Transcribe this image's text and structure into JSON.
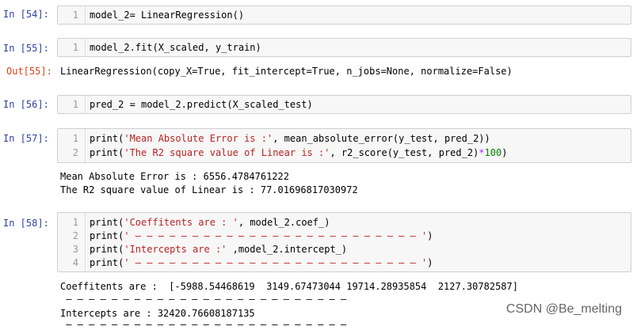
{
  "cells": [
    {
      "prompt": "In  [54]:",
      "lines": [
        {
          "n": "1",
          "text": "model_2= LinearRegression()"
        }
      ]
    },
    {
      "prompt": "In  [55]:",
      "lines": [
        {
          "n": "1",
          "text": "model_2.fit(X_scaled, y_train)"
        }
      ],
      "out_prompt": "Out[55]:",
      "output": "LinearRegression(copy_X=True, fit_intercept=True, n_jobs=None, normalize=False)"
    },
    {
      "prompt": "In  [56]:",
      "lines": [
        {
          "n": "1",
          "text": "pred_2 = model_2.predict(X_scaled_test)"
        }
      ]
    },
    {
      "prompt": "In  [57]:",
      "lines": [
        {
          "n": "1",
          "pre": "print(",
          "str": "'Mean Absolute Error is :'",
          "post": ", mean_absolute_error(y_test, pred_2))"
        },
        {
          "n": "2",
          "pre": "print(",
          "str": "'The R2 square value of Linear is :'",
          "post": ", r2_score(y_test, pred_2)",
          "op": "*",
          "num": "100",
          "end": ")"
        }
      ],
      "output_lines": [
        "Mean Absolute Error is : 6556.4784761222",
        "The R2 square value of Linear is : 77.01696817030972"
      ]
    },
    {
      "prompt": "In  [58]:",
      "lines": [
        {
          "n": "1",
          "pre": "print(",
          "str": "'Coeffitents are : '",
          "post": ", model_2.coef_)"
        },
        {
          "n": "2",
          "pre": "print(",
          "str": "' — — — — — — — — — — — — — — — — — — — — — — — — — '",
          "post": ")"
        },
        {
          "n": "3",
          "pre": "print(",
          "str": "'Intercepts are :'",
          "post": " ,model_2.intercept_)"
        },
        {
          "n": "4",
          "pre": "print(",
          "str": "' — — — — — — — — — — — — — — — — — — — — — — — — — '",
          "post": ")"
        }
      ],
      "output_lines": [
        "Coeffitents are :  [-5988.54468619  3149.67473044 19714.28935854  2127.30782587]",
        " — — — — — — — — — — — — — — — — — — — — — — — — — ",
        "Intercepts are : 32420.76608187135",
        " — — — — — — — — — — — — — — — — — — — — — — — — — "
      ]
    }
  ],
  "watermark": "CSDN @Be_melting"
}
